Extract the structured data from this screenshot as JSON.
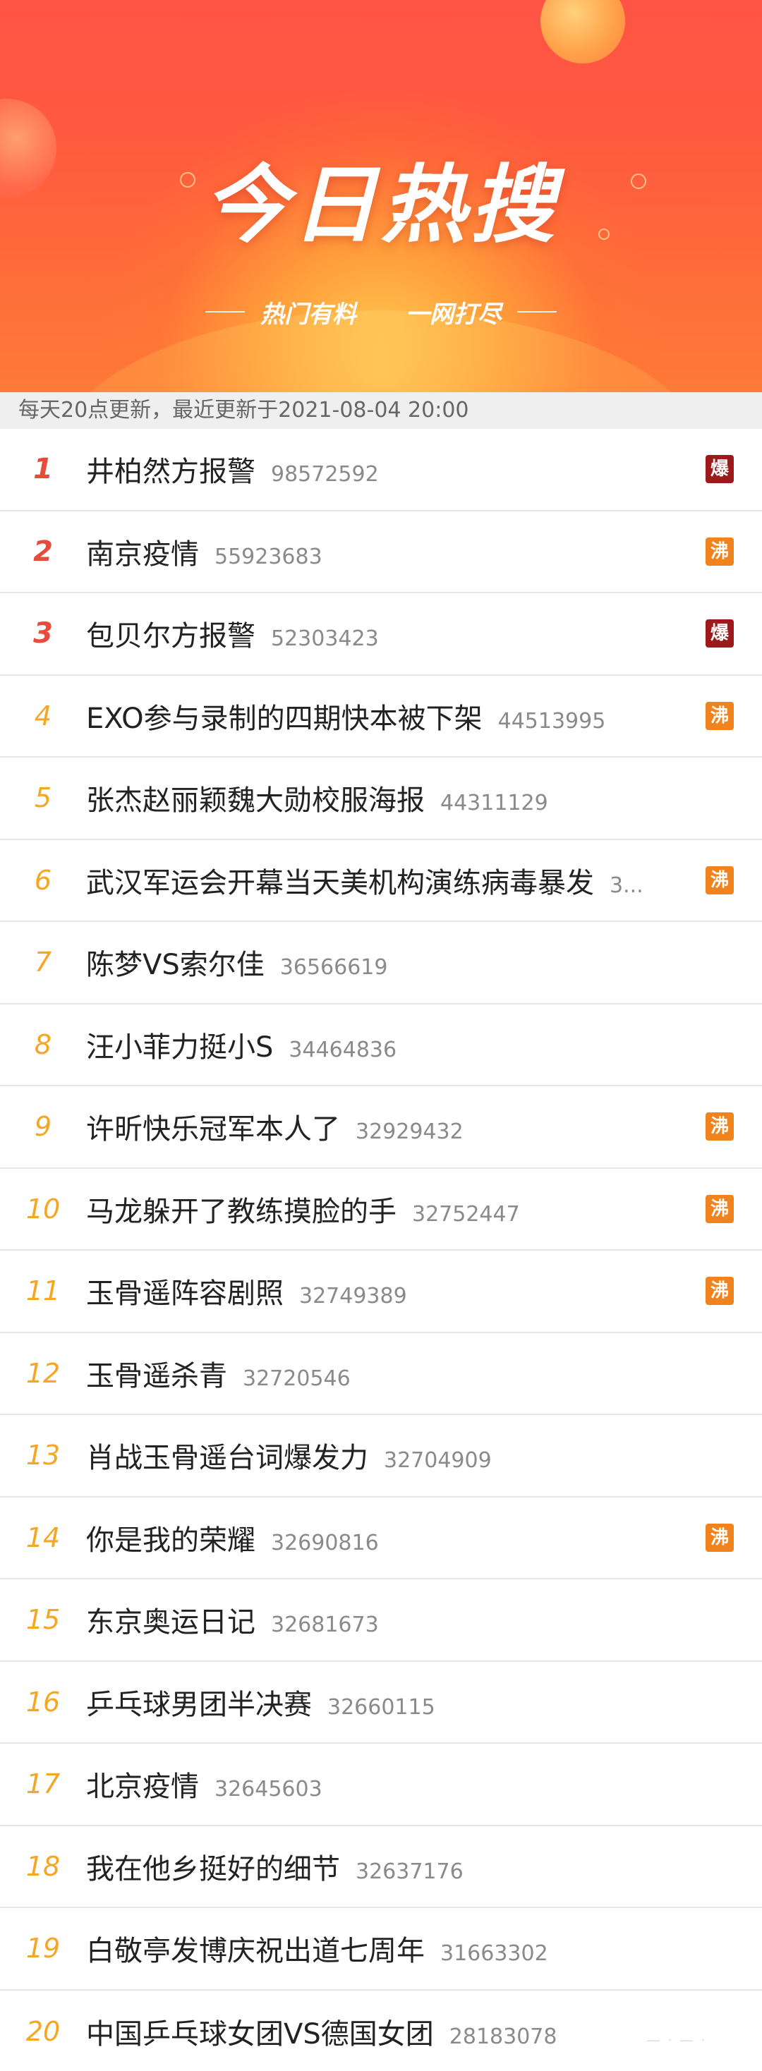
{
  "banner": {
    "title": "今日热搜",
    "subtitle_left": "热门有料",
    "subtitle_right": "一网打尽"
  },
  "update_text": "每天20点更新，最近更新于2021-08-04 20:00",
  "colors": {
    "rank_top": "#e84a3c",
    "rank_other": "#f5a623",
    "badge_hot": "#9e1a1a",
    "badge_boil": "#f0831e"
  },
  "items": [
    {
      "rank": "1",
      "title": "井柏然方报警",
      "count": "98572592",
      "badge": "爆",
      "badge_type": "hot"
    },
    {
      "rank": "2",
      "title": "南京疫情",
      "count": "55923683",
      "badge": "沸",
      "badge_type": "boil"
    },
    {
      "rank": "3",
      "title": "包贝尔方报警",
      "count": "52303423",
      "badge": "爆",
      "badge_type": "hot"
    },
    {
      "rank": "4",
      "title": "EXO参与录制的四期快本被下架",
      "count": "44513995",
      "badge": "沸",
      "badge_type": "boil"
    },
    {
      "rank": "5",
      "title": "张杰赵丽颖魏大勋校服海报",
      "count": "44311129",
      "badge": "",
      "badge_type": ""
    },
    {
      "rank": "6",
      "title": "武汉军运会开幕当天美机构演练病毒暴发",
      "count": "3...",
      "badge": "沸",
      "badge_type": "boil"
    },
    {
      "rank": "7",
      "title": "陈梦VS索尔佳",
      "count": "36566619",
      "badge": "",
      "badge_type": ""
    },
    {
      "rank": "8",
      "title": "汪小菲力挺小S",
      "count": "34464836",
      "badge": "",
      "badge_type": ""
    },
    {
      "rank": "9",
      "title": "许昕快乐冠军本人了",
      "count": "32929432",
      "badge": "沸",
      "badge_type": "boil"
    },
    {
      "rank": "10",
      "title": "马龙躲开了教练摸脸的手",
      "count": "32752447",
      "badge": "沸",
      "badge_type": "boil"
    },
    {
      "rank": "11",
      "title": "玉骨遥阵容剧照",
      "count": "32749389",
      "badge": "沸",
      "badge_type": "boil"
    },
    {
      "rank": "12",
      "title": "玉骨遥杀青",
      "count": "32720546",
      "badge": "",
      "badge_type": ""
    },
    {
      "rank": "13",
      "title": "肖战玉骨遥台词爆发力",
      "count": "32704909",
      "badge": "",
      "badge_type": ""
    },
    {
      "rank": "14",
      "title": "你是我的荣耀",
      "count": "32690816",
      "badge": "沸",
      "badge_type": "boil"
    },
    {
      "rank": "15",
      "title": "东京奥运日记",
      "count": "32681673",
      "badge": "",
      "badge_type": ""
    },
    {
      "rank": "16",
      "title": "乒乓球男团半决赛",
      "count": "32660115",
      "badge": "",
      "badge_type": ""
    },
    {
      "rank": "17",
      "title": "北京疫情",
      "count": "32645603",
      "badge": "",
      "badge_type": ""
    },
    {
      "rank": "18",
      "title": "我在他乡挺好的细节",
      "count": "32637176",
      "badge": "",
      "badge_type": ""
    },
    {
      "rank": "19",
      "title": "白敬亭发博庆祝出道七周年",
      "count": "31663302",
      "badge": "",
      "badge_type": ""
    },
    {
      "rank": "20",
      "title": "中国乒乓球女团VS德国女团",
      "count": "28183078",
      "badge": "",
      "badge_type": ""
    }
  ]
}
